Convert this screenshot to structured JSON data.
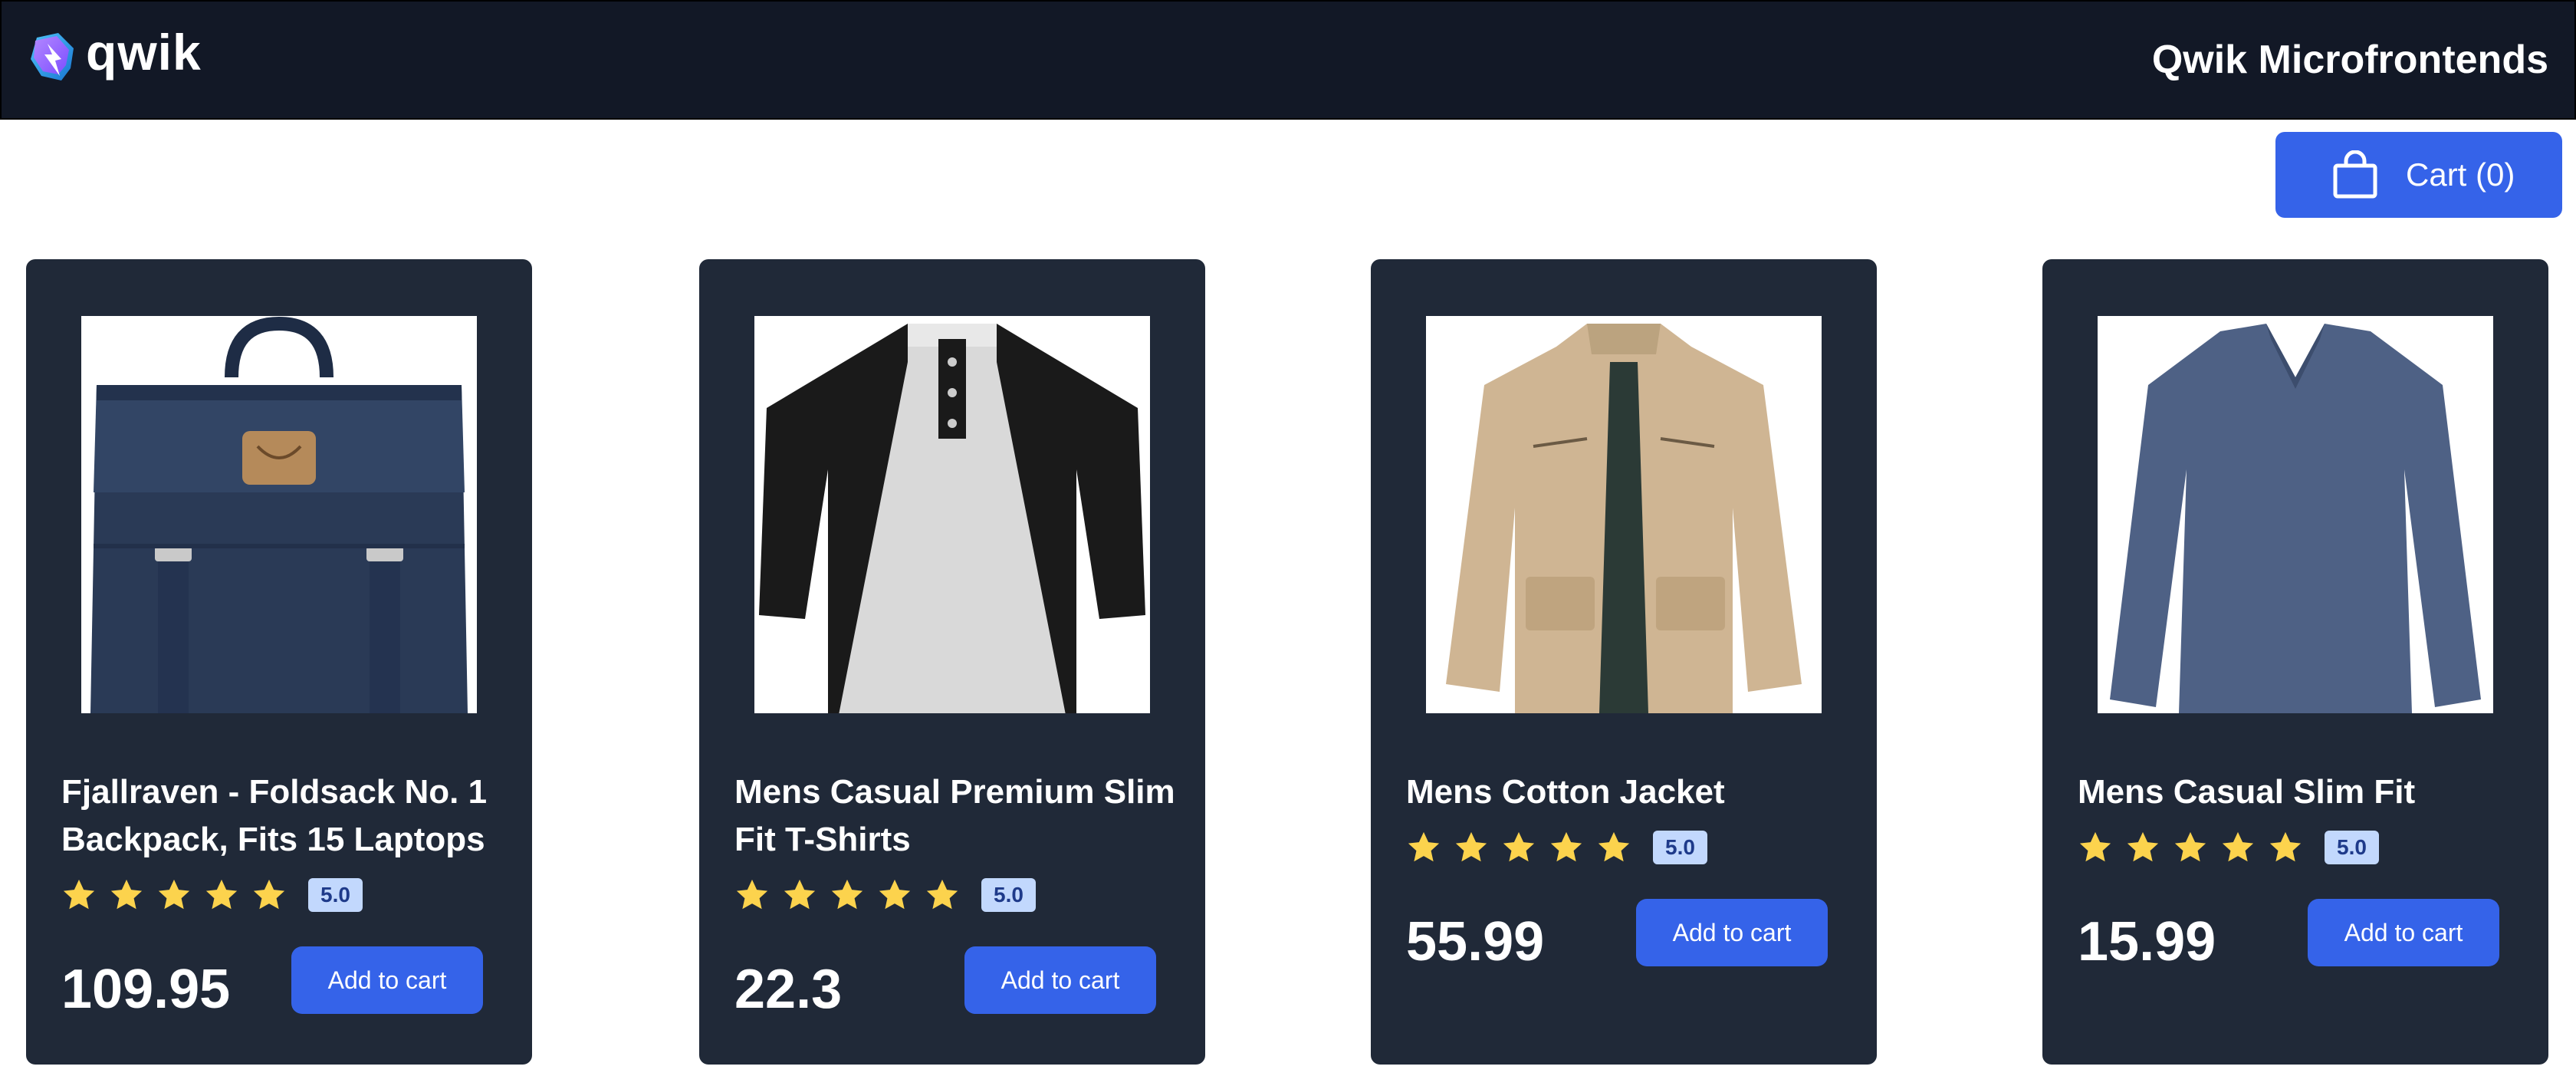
{
  "header": {
    "logo_text": "qwik",
    "title": "Qwik Microfrontends"
  },
  "cart": {
    "label": "Cart (0)"
  },
  "colors": {
    "header_bg": "#121826",
    "card_bg": "#202938",
    "accent": "#3563e9",
    "star": "#fcd34d",
    "badge_bg": "#c2d8fd"
  },
  "products": [
    {
      "title": "Fjallraven - Foldsack No. 1 Backpack, Fits 15 Laptops",
      "rating": "5.0",
      "stars": 5,
      "price": "109.95",
      "button": "Add to cart",
      "image_icon": "backpack-image"
    },
    {
      "title": "Mens Casual Premium Slim Fit T-Shirts",
      "rating": "5.0",
      "stars": 5,
      "price": "22.3",
      "button": "Add to cart",
      "image_icon": "raglan-shirt-image"
    },
    {
      "title": "Mens Cotton Jacket",
      "rating": "5.0",
      "stars": 5,
      "price": "55.99",
      "button": "Add to cart",
      "image_icon": "jacket-image"
    },
    {
      "title": "Mens Casual Slim Fit",
      "rating": "5.0",
      "stars": 5,
      "price": "15.99",
      "button": "Add to cart",
      "image_icon": "long-sleeve-shirt-image"
    }
  ]
}
